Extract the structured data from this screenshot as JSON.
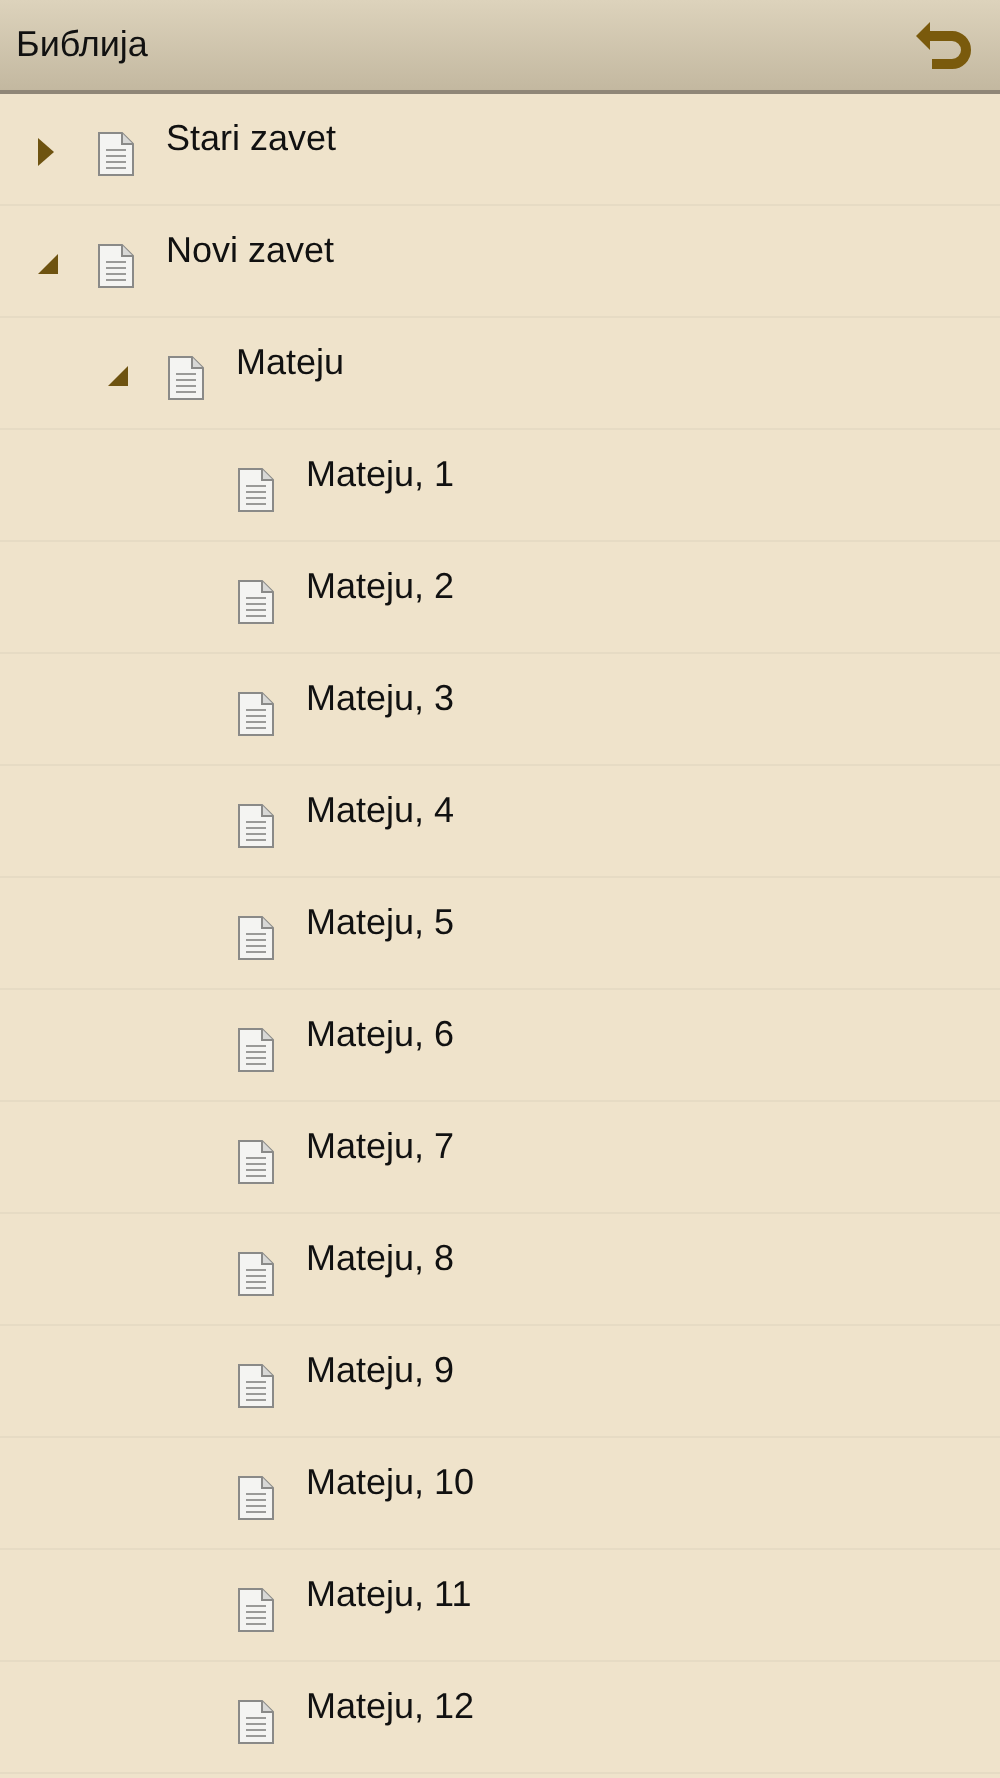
{
  "header": {
    "title": "Библија"
  },
  "tree": [
    {
      "label": "Stari zavet",
      "expanded": false
    },
    {
      "label": "Novi zavet",
      "expanded": true,
      "children": [
        {
          "label": "Mateju",
          "expanded": true,
          "children": [
            {
              "label": "Mateju, 1"
            },
            {
              "label": "Mateju, 2"
            },
            {
              "label": "Mateju, 3"
            },
            {
              "label": "Mateju, 4"
            },
            {
              "label": "Mateju, 5"
            },
            {
              "label": "Mateju, 6"
            },
            {
              "label": "Mateju, 7"
            },
            {
              "label": "Mateju, 8"
            },
            {
              "label": "Mateju, 9"
            },
            {
              "label": "Mateju, 10"
            },
            {
              "label": "Mateju, 11"
            },
            {
              "label": "Mateju, 12"
            }
          ]
        }
      ]
    }
  ]
}
